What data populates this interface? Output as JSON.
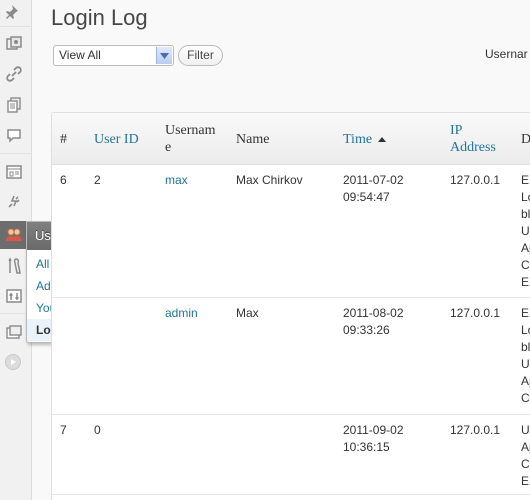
{
  "page": {
    "title": "Login Log"
  },
  "filter": {
    "selected": "View All",
    "button_label": "Filter",
    "username_label": "Usernar"
  },
  "menu": {
    "icons": [
      "pin-icon",
      "media-icon",
      "links-icon",
      "pages-icon",
      "comments-icon",
      "appearance-icon",
      "plugins-icon",
      "users-icon",
      "tools-icon",
      "settings-icon",
      "dashboard-icon",
      "collapse-icon"
    ],
    "flyout": {
      "header": "Users",
      "items": [
        {
          "label": "All Users",
          "current": false
        },
        {
          "label": "Add New",
          "current": false
        },
        {
          "label": "Your Profile",
          "current": false
        },
        {
          "label": "Login Log",
          "current": true
        }
      ]
    }
  },
  "table": {
    "headers": [
      "#",
      "User ID",
      "Usernam\ne",
      "Name",
      "Time",
      "IP\nAddress",
      "D"
    ],
    "sorted_column": "Time",
    "rows": [
      {
        "num": "6",
        "user_id": "2",
        "username": "max",
        "name": "Max Chirkov",
        "time": "2011-07-02\n09:54:47",
        "ip": "127.0.0.1",
        "d": "E\nLo\nbl\nU\nAp\nC\nE"
      },
      {
        "num": "",
        "user_id": "",
        "username": "admin",
        "name": "Max",
        "time": "2011-08-02\n09:33:26",
        "ip": "127.0.0.1",
        "d": "E\nLo\nbl\nU\nAp\nC"
      },
      {
        "num": "7",
        "user_id": "0",
        "username": "",
        "name": "",
        "time": "2011-09-02\n10:36:15",
        "ip": "127.0.0.1",
        "d": "U\nAp\nC\nE"
      }
    ]
  },
  "colors": {
    "link": "#21759b",
    "menu_current": "#6d6d6d",
    "flyout_current_bg": "#eaf2fa"
  }
}
